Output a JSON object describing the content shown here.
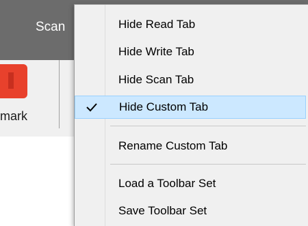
{
  "app": {
    "tab_partial_label": "Scan",
    "bookmark_partial_label": "mark"
  },
  "menu": {
    "items": [
      {
        "label": "Hide Read Tab",
        "checked": false
      },
      {
        "label": "Hide Write Tab",
        "checked": false
      },
      {
        "label": "Hide Scan Tab",
        "checked": false
      },
      {
        "label": "Hide Custom Tab",
        "checked": true
      },
      {
        "label": "Rename Custom Tab",
        "checked": false
      },
      {
        "label": "Load a Toolbar Set",
        "checked": false
      },
      {
        "label": "Save Toolbar Set",
        "checked": false
      }
    ]
  },
  "colors": {
    "tab_strip": "#6c6c6c",
    "highlight_bg": "#cce8ff",
    "highlight_border": "#99d1ff",
    "bookmark_icon": "#e8412c"
  }
}
